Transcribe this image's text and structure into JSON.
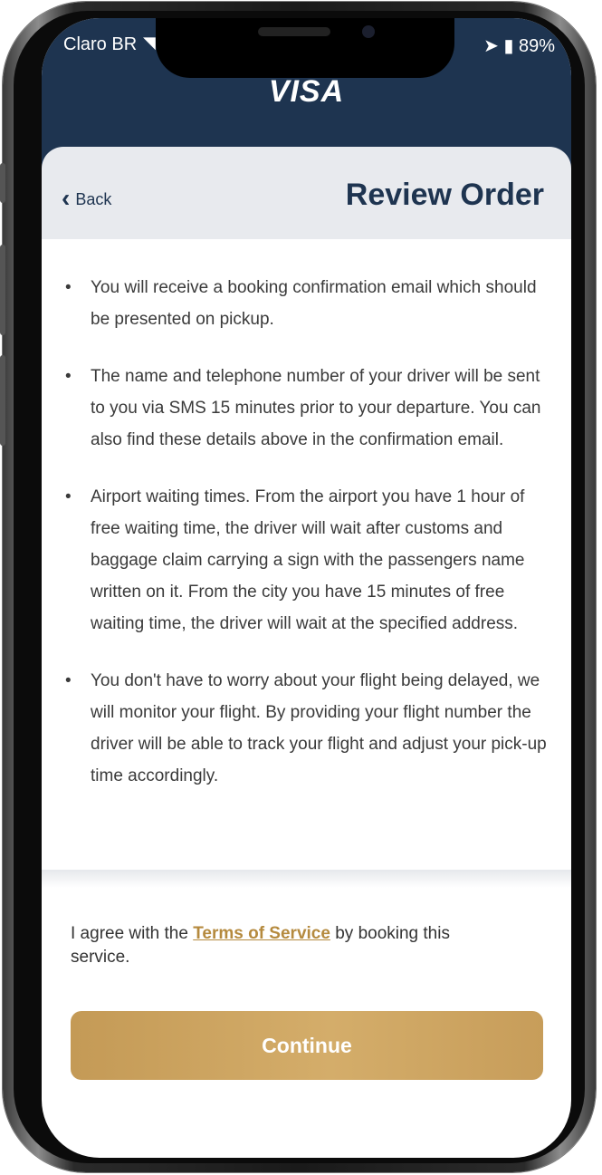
{
  "status_bar": {
    "carrier": "Claro BR",
    "battery": "89%"
  },
  "header": {
    "brand": "VISA",
    "back_label": "Back",
    "title": "Review Order"
  },
  "notes": [
    "You will receive a booking confirmation email which should be presented on pickup.",
    "The name and telephone number of your driver will be sent to you via SMS 15 minutes prior to your departure. You can also find these details above in the confirmation email.",
    "Airport waiting times. From the airport you have 1 hour of free waiting time, the driver will wait after customs and baggage claim carrying a sign with the passengers name written on it. From the city you have 15 minutes of free waiting time, the driver will wait at the specified address.",
    "You don't have to worry about your flight being delayed, we will monitor your flight. By providing your flight number the driver will be able to track your flight and adjust your pick-up time accordingly."
  ],
  "terms": {
    "prefix": "I agree with the",
    "link": "Terms of Service",
    "suffix": "by booking this service."
  },
  "continue_label": "Continue",
  "colors": {
    "header_bg": "#1e3450",
    "accent": "#c9a05c",
    "link": "#b58a3e"
  }
}
